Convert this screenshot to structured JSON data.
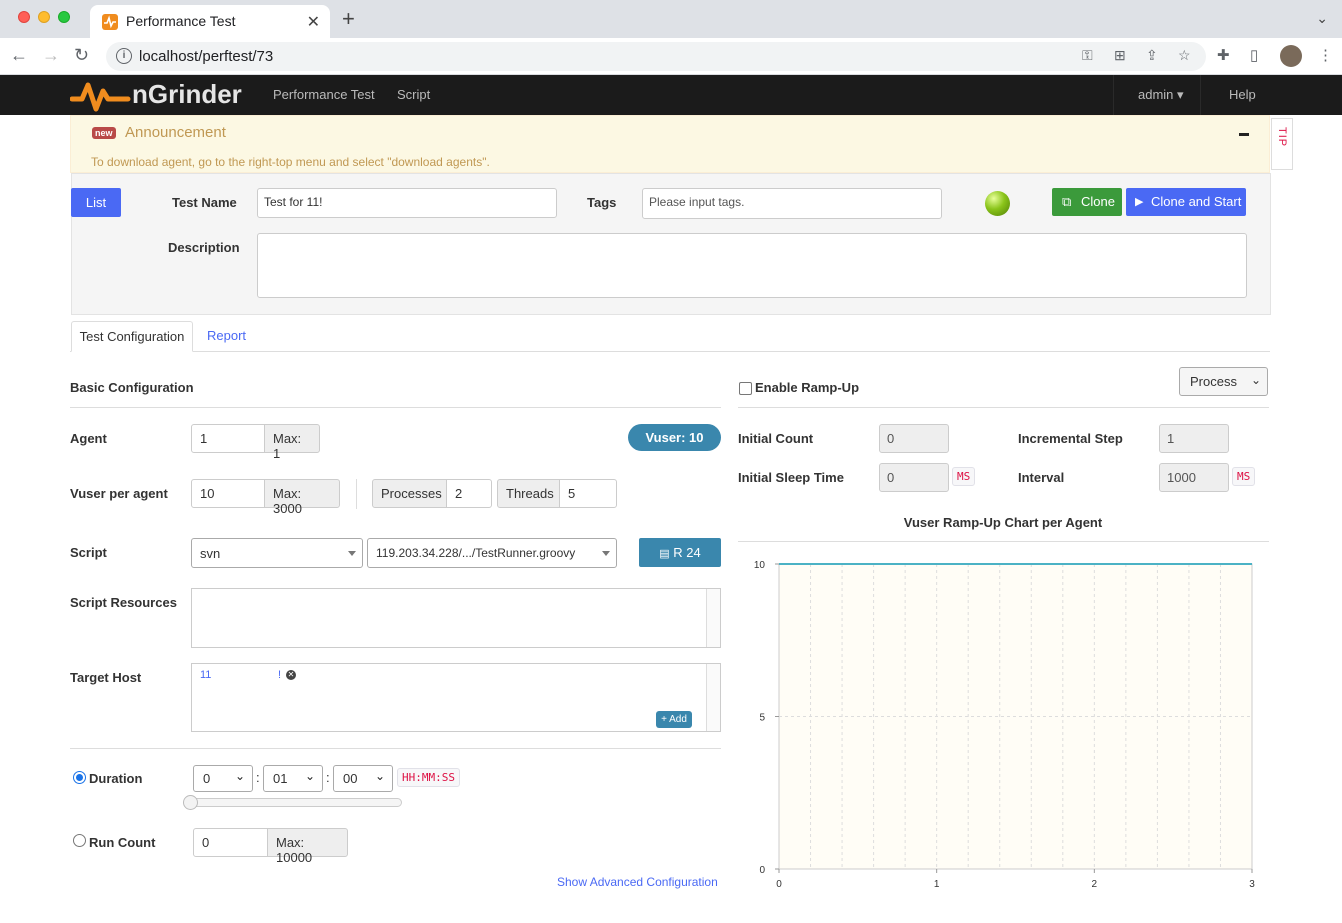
{
  "browser": {
    "tab_title": "Performance Test",
    "tab_close": "✕",
    "new_tab": "+",
    "url": "localhost/perftest/73"
  },
  "navbar": {
    "logo_text": "nGrinder",
    "links": [
      "Performance Test",
      "Script"
    ],
    "user_menu": "admin ▾",
    "help": "Help"
  },
  "announcement": {
    "badge": "new",
    "title": "Announcement",
    "text": "To download agent, go to the right-top menu and select \"download agents\".",
    "tip": "TIP"
  },
  "header": {
    "list_button": "List",
    "test_name_label": "Test Name",
    "test_name_value": "Test for 11!",
    "tags_label": "Tags",
    "tags_placeholder": "Please input tags.",
    "clone_button": "Clone",
    "clone_start_button": "Clone and Start",
    "description_label": "Description",
    "description_value": ""
  },
  "tabs": {
    "active": "Test Configuration",
    "other": "Report"
  },
  "basic": {
    "title": "Basic Configuration",
    "agent_label": "Agent",
    "agent_value": "1",
    "agent_max": "Max: 1",
    "vuser_badge": "Vuser: 10",
    "vuser_label": "Vuser per agent",
    "vuser_value": "10",
    "vuser_max": "Max: 3000",
    "processes_label": "Processes",
    "processes_value": "2",
    "threads_label": "Threads",
    "threads_value": "5",
    "script_label": "Script",
    "script_repo": "svn",
    "script_file": "119.203.34.228/.../TestRunner.groovy",
    "revision_button": "R 24",
    "resources_label": "Script Resources",
    "target_host_label": "Target Host",
    "target_host_value": "11",
    "target_host_suffix": "!",
    "add_button": "+ Add",
    "duration_label": "Duration",
    "duration_hours": "0",
    "duration_minutes": "01",
    "duration_seconds": "00",
    "duration_sep": ":",
    "duration_format": "HH:MM:SS",
    "duration_mode_selected": true,
    "run_count_label": "Run Count",
    "run_count_value": "0",
    "run_count_max": "Max: 10000",
    "advanced_link": "Show Advanced Configuration"
  },
  "rampup": {
    "enable_label": "Enable Ramp-Up",
    "enabled": false,
    "mode": "Process",
    "initial_count_label": "Initial Count",
    "initial_count_value": "0",
    "incremental_step_label": "Incremental Step",
    "incremental_step_value": "1",
    "initial_sleep_label": "Initial Sleep Time",
    "initial_sleep_value": "0",
    "interval_label": "Interval",
    "interval_value": "1000",
    "unit_ms": "MS"
  },
  "chart_data": {
    "type": "line",
    "title": "Vuser Ramp-Up Chart per Agent",
    "xlabel": "",
    "ylabel": "",
    "x_ticks": [
      "0",
      "1",
      "2",
      "3"
    ],
    "y_ticks": [
      "0",
      "5",
      "10"
    ],
    "xlim": [
      0,
      3
    ],
    "ylim": [
      0,
      10
    ],
    "series": [
      {
        "x": [
          0,
          3
        ],
        "values": [
          10,
          10
        ]
      }
    ],
    "grid": true,
    "colors": {
      "line": "#4bb2c5",
      "background": "#fffdf6"
    }
  }
}
